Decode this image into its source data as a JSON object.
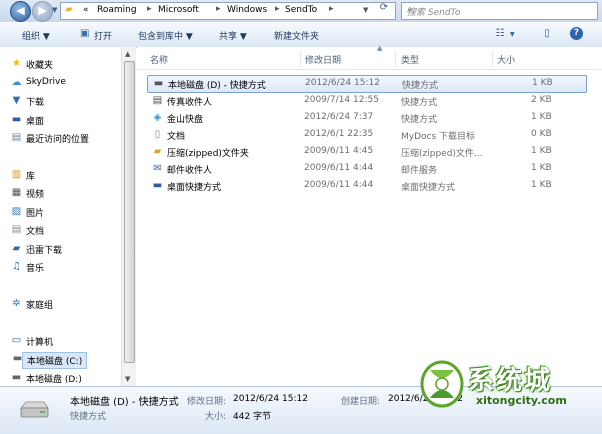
{
  "address": {
    "breadcrumbs": [
      "«",
      "Roaming",
      "Microsoft",
      "Windows",
      "SendTo"
    ],
    "search_placeholder": "搜索 SendTo"
  },
  "toolbar": {
    "organize": "组织 ▼",
    "open": "打开",
    "include": "包含到库中 ▼",
    "share": "共享 ▼",
    "new_folder": "新建文件夹"
  },
  "sidebar": {
    "favorites": "收藏夹",
    "skydrive": "SkyDrive",
    "downloads": "下载",
    "desktop": "桌面",
    "recent": "最近访问的位置",
    "libraries": "库",
    "videos": "视频",
    "pictures": "图片",
    "documents": "文档",
    "xunlei": "迅雷下载",
    "music": "音乐",
    "homegroup": "家庭组",
    "computer": "计算机",
    "drive_c": "本地磁盘 (C:)",
    "drive_d": "本地磁盘 (D:)"
  },
  "columns": {
    "name": "名称",
    "modified": "修改日期",
    "type": "类型",
    "size": "大小"
  },
  "files": [
    {
      "name": "本地磁盘 (D) - 快捷方式",
      "modified": "2012/6/24 15:12",
      "type": "快捷方式",
      "size": "1 KB",
      "icon": "shortcut-drive-icon"
    },
    {
      "name": "传真收件人",
      "modified": "2009/7/14 12:55",
      "type": "快捷方式",
      "size": "2 KB",
      "icon": "fax-icon"
    },
    {
      "name": "金山快盘",
      "modified": "2012/6/24 7:37",
      "type": "快捷方式",
      "size": "1 KB",
      "icon": "kuaipan-icon"
    },
    {
      "name": "文档",
      "modified": "2012/6/1 22:35",
      "type": "MyDocs 下载目标",
      "size": "0 KB",
      "icon": "document-icon"
    },
    {
      "name": "压缩(zipped)文件夹",
      "modified": "2009/6/11 4:45",
      "type": "压缩(zipped)文件...",
      "size": "1 KB",
      "icon": "zip-folder-icon"
    },
    {
      "name": "邮件收件人",
      "modified": "2009/6/11 4:44",
      "type": "邮件服务",
      "size": "1 KB",
      "icon": "mail-icon"
    },
    {
      "name": "桌面快捷方式",
      "modified": "2009/6/11 4:44",
      "type": "桌面快捷方式",
      "size": "1 KB",
      "icon": "desktop-shortcut-icon"
    }
  ],
  "details": {
    "name": "本地磁盘 (D) - 快捷方式",
    "modified_label": "修改日期:",
    "modified": "2012/6/24 15:12",
    "created_label": "创建日期:",
    "created": "2012/6/24 15:12",
    "type": "快捷方式",
    "size_label": "大小:",
    "size": "442 字节"
  },
  "watermark": {
    "brand": "系统城",
    "url": "xitongcity.com"
  },
  "colors": {
    "accent": "#2a62b4",
    "selection": "#dbe8f8",
    "watermark_green": "#5aa52a"
  }
}
